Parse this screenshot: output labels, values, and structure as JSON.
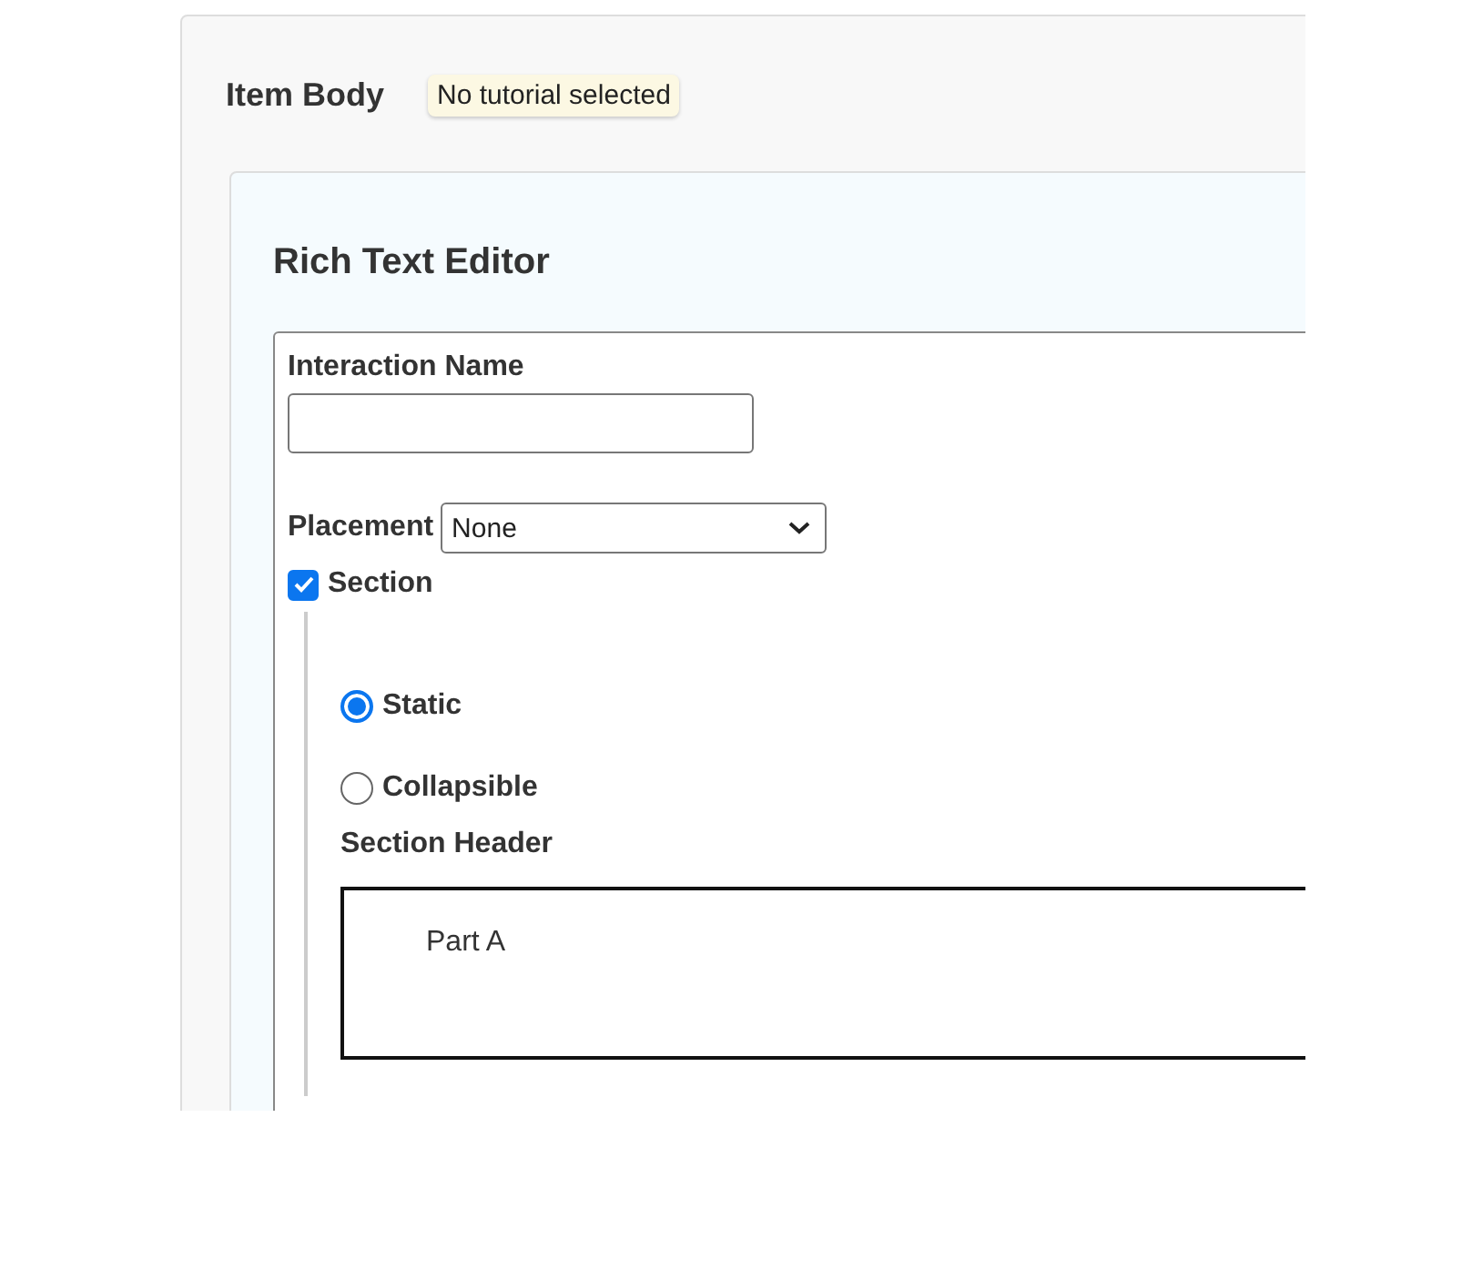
{
  "panel": {
    "title": "Item Body",
    "badge": "No tutorial selected"
  },
  "editor": {
    "title": "Rich Text Editor",
    "interaction_name": {
      "label": "Interaction Name"
    },
    "placement": {
      "label": "Placement",
      "value": "None"
    },
    "section": {
      "label": "Section",
      "checked": true
    },
    "section_types": [
      {
        "label": "Static",
        "selected": true
      },
      {
        "label": "Collapsible",
        "selected": false
      }
    ],
    "section_header": {
      "label": "Section Header",
      "value": "Part A"
    }
  }
}
